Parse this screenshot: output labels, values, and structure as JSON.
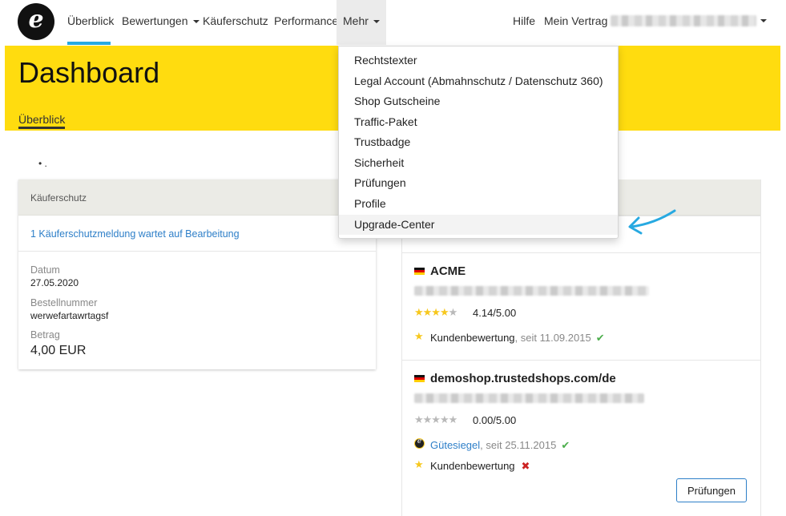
{
  "navbar": {
    "logo_letter": "e",
    "items": [
      {
        "label": "Überblick",
        "active": true
      },
      {
        "label": "Bewertungen",
        "dropdown": true
      },
      {
        "label": "Käuferschutz"
      },
      {
        "label": "Performance"
      },
      {
        "label": "Mehr",
        "dropdown": true,
        "open": true
      }
    ],
    "right": {
      "help": "Hilfe",
      "contract": "Mein Vertrag"
    }
  },
  "hero": {
    "title": "Dashboard",
    "tab": "Überblick"
  },
  "bullet_text": ".",
  "dropdown": {
    "items": [
      {
        "label": "Rechtstexter"
      },
      {
        "label": "Legal Account (Abmahnschutz / Datenschutz 360)"
      },
      {
        "label": "Shop Gutscheine"
      },
      {
        "label": "Traffic-Paket"
      },
      {
        "label": "Trustbadge"
      },
      {
        "label": "Sicherheit"
      },
      {
        "label": "Prüfungen"
      },
      {
        "label": "Profile"
      },
      {
        "label": "Upgrade-Center",
        "highlighted": true
      }
    ]
  },
  "buyer_protection": {
    "header": "Käuferschutz",
    "notice_link": "1 Käuferschutzmeldung wartet auf Bearbeitung",
    "date_label": "Datum",
    "date_value": "27.05.2020",
    "order_label": "Bestellnummer",
    "order_value": "werwefartawrtagsf",
    "amount_label": "Betrag",
    "amount_value": "4,00 EUR"
  },
  "shops": [
    {
      "name": "ACME",
      "stars_filled": 4,
      "rating": "4.14/5.00",
      "features": [
        {
          "icon": "star-icon",
          "label": "Kundenbewertung",
          "since": ", seit 11.09.2015",
          "status": "check"
        }
      ]
    },
    {
      "name": "demoshop.trustedshops.com/de",
      "stars_filled": 0,
      "rating": "0.00/5.00",
      "features": [
        {
          "icon": "seal-icon",
          "label": "Gütesiegel",
          "since": ", seit 25.11.2015",
          "status": "check"
        },
        {
          "icon": "star-icon",
          "label": "Kundenbewertung",
          "since": "",
          "status": "cross"
        }
      ],
      "button": "Prüfungen"
    }
  ],
  "colors": {
    "brand_yellow": "#ffdc0f",
    "link_blue": "#2e7fc8",
    "active_blue": "#27a9e1",
    "arrow_blue": "#27a9e1"
  }
}
